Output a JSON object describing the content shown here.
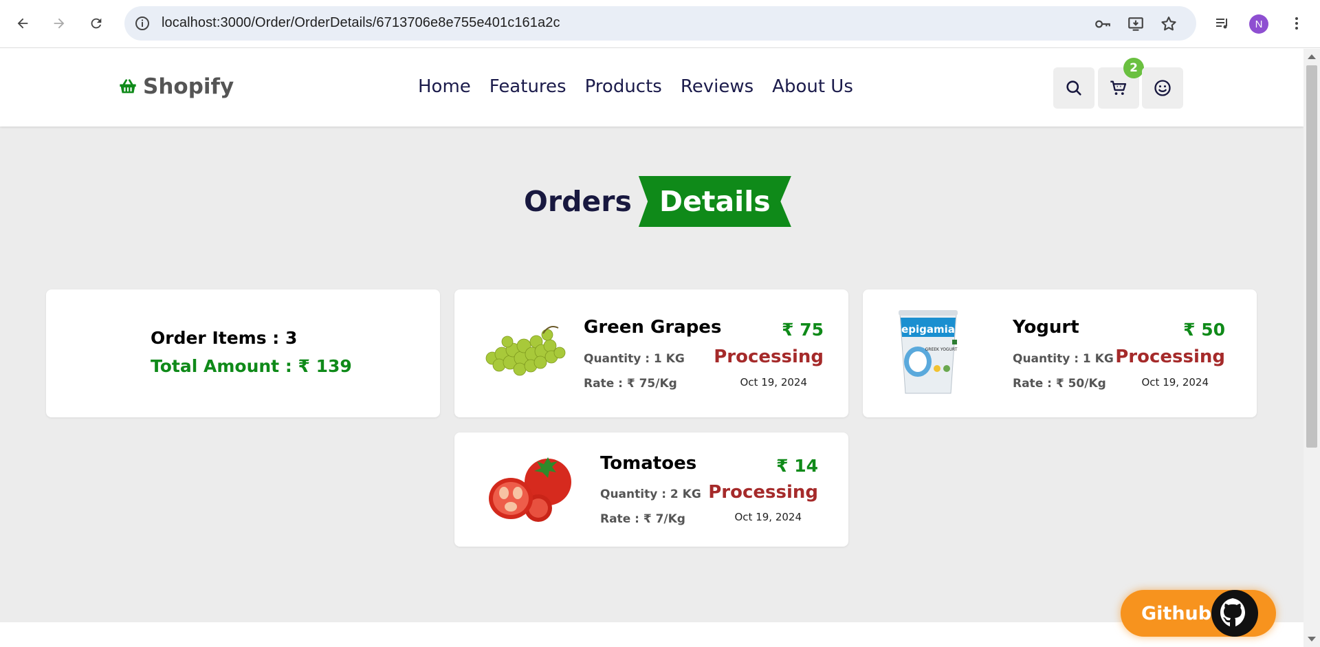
{
  "browser": {
    "url": "localhost:3000/Order/OrderDetails/6713706e8e755e401c161a2c",
    "profile_initial": "N"
  },
  "header": {
    "logo": "Shopify",
    "nav": [
      "Home",
      "Features",
      "Products",
      "Reviews",
      "About Us"
    ],
    "cart_count": "2"
  },
  "heading": {
    "part1": "Orders",
    "part2": "Details"
  },
  "summary": {
    "items": "Order Items : 3",
    "total": "Total Amount : ₹ 139"
  },
  "orders": [
    {
      "name": "Green Grapes",
      "qty": "Quantity : 1 KG",
      "rate": "Rate : ₹ 75/Kg",
      "price": "₹ 75",
      "status": "Processing",
      "date": "Oct 19, 2024",
      "image": "grapes"
    },
    {
      "name": "Yogurt",
      "qty": "Quantity : 1 KG",
      "rate": "Rate : ₹ 50/Kg",
      "price": "₹ 50",
      "status": "Processing",
      "date": "Oct 19, 2024",
      "image": "yogurt-cup",
      "brand": "epigamia",
      "sub": "GREEK YOGURT"
    },
    {
      "name": "Tomatoes",
      "qty": "Quantity : 2 KG",
      "rate": "Rate : ₹ 7/Kg",
      "price": "₹ 14",
      "status": "Processing",
      "date": "Oct 19, 2024",
      "image": "tomatoes"
    }
  ],
  "github": {
    "label": "Github"
  },
  "colors": {
    "accent_green": "#0f8a19",
    "status_red": "#a52a2a",
    "github_orange": "#f7931e",
    "navy": "#18183f"
  }
}
